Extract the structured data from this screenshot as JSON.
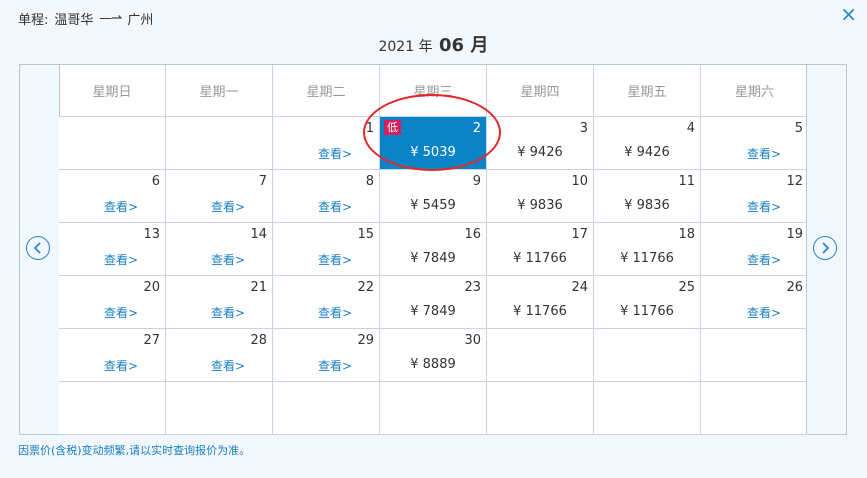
{
  "route": {
    "label": "单程:",
    "from": "温哥华",
    "arrow": "—⇀",
    "to": "广州"
  },
  "month": {
    "year": "2021",
    "year_unit": "年",
    "month": "06",
    "month_unit": "月"
  },
  "weekdays": [
    "星期日",
    "星期一",
    "星期二",
    "星期三",
    "星期四",
    "星期五",
    "星期六"
  ],
  "view_label": "查看>",
  "low_label": "低",
  "close_icon": "×",
  "weeks": [
    [
      {
        "day": ""
      },
      {
        "day": ""
      },
      {
        "day": "1",
        "view": true
      },
      {
        "day": "2",
        "price": "¥ 5039",
        "selected": true,
        "low": true
      },
      {
        "day": "3",
        "price": "¥ 9426"
      },
      {
        "day": "4",
        "price": "¥ 9426"
      },
      {
        "day": "5",
        "view": true
      }
    ],
    [
      {
        "day": "6",
        "view": true
      },
      {
        "day": "7",
        "view": true
      },
      {
        "day": "8",
        "view": true
      },
      {
        "day": "9",
        "price": "¥ 5459"
      },
      {
        "day": "10",
        "price": "¥ 9836"
      },
      {
        "day": "11",
        "price": "¥ 9836"
      },
      {
        "day": "12",
        "view": true
      }
    ],
    [
      {
        "day": "13",
        "view": true
      },
      {
        "day": "14",
        "view": true
      },
      {
        "day": "15",
        "view": true
      },
      {
        "day": "16",
        "price": "¥ 7849"
      },
      {
        "day": "17",
        "price": "¥ 11766"
      },
      {
        "day": "18",
        "price": "¥ 11766"
      },
      {
        "day": "19",
        "view": true
      }
    ],
    [
      {
        "day": "20",
        "view": true
      },
      {
        "day": "21",
        "view": true
      },
      {
        "day": "22",
        "view": true
      },
      {
        "day": "23",
        "price": "¥ 7849"
      },
      {
        "day": "24",
        "price": "¥ 11766"
      },
      {
        "day": "25",
        "price": "¥ 11766"
      },
      {
        "day": "26",
        "view": true
      }
    ],
    [
      {
        "day": "27",
        "view": true
      },
      {
        "day": "28",
        "view": true
      },
      {
        "day": "29",
        "view": true
      },
      {
        "day": "30",
        "price": "¥ 8889"
      },
      {
        "day": ""
      },
      {
        "day": ""
      },
      {
        "day": ""
      }
    ],
    [
      {
        "day": ""
      },
      {
        "day": ""
      },
      {
        "day": ""
      },
      {
        "day": ""
      },
      {
        "day": ""
      },
      {
        "day": ""
      },
      {
        "day": ""
      }
    ]
  ],
  "footnote": "因票价(含税)变动频繁,请以实时查询报价为准。",
  "colors": {
    "accent": "#1e88c7",
    "selected_bg": "#0a83c7",
    "low_badge": "#d81e5b",
    "highlight": "#e3272b"
  }
}
